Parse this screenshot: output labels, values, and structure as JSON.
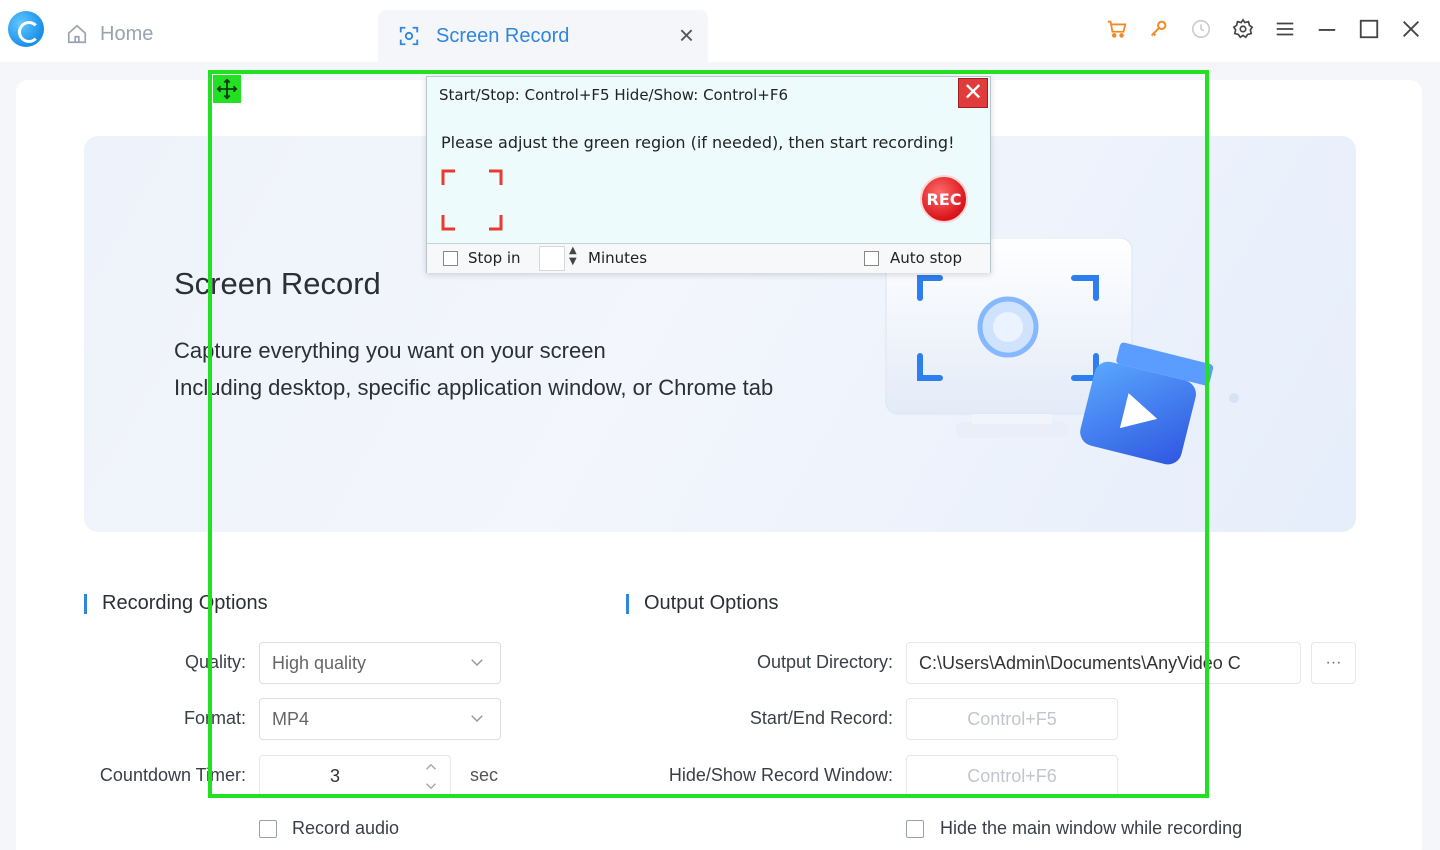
{
  "titlebar": {
    "home_tab": "Home",
    "active_tab": "Screen Record",
    "icons": [
      "cart-icon",
      "key-icon",
      "history-icon",
      "gear-icon",
      "menu-icon",
      "minimize-icon",
      "maximize-icon",
      "close-icon"
    ],
    "accent": "#2e86de"
  },
  "hero": {
    "title": "Screen Record",
    "line1": "Capture everything you want on your screen",
    "line2": "Including desktop, specific application window, or Chrome tab"
  },
  "recording_options": {
    "title": "Recording Options",
    "quality_label": "Quality:",
    "quality_value": "High quality",
    "format_label": "Format:",
    "format_value": "MP4",
    "countdown_label": "Countdown Timer:",
    "countdown_value": "3",
    "countdown_unit": "sec",
    "record_audio": "Record audio"
  },
  "output_options": {
    "title": "Output Options",
    "directory_label": "Output Directory:",
    "directory_value": "C:\\Users\\Admin\\Documents\\AnyVideo C",
    "browse_label": "···",
    "start_end_label": "Start/End Record:",
    "start_end_value": "Control+F5",
    "hide_show_label": "Hide/Show Record Window:",
    "hide_show_value": "Control+F6",
    "hide_main": "Hide the main window while recording"
  },
  "popup": {
    "hotkeys": "Start/Stop: Control+F5   Hide/Show: Control+F6",
    "close": "✕",
    "message": "Please adjust the green region (if needed), then start recording!",
    "rec": "REC",
    "stop_in": "Stop in",
    "minutes": "Minutes",
    "auto_stop": "Auto stop"
  },
  "region_color": "#22e022"
}
